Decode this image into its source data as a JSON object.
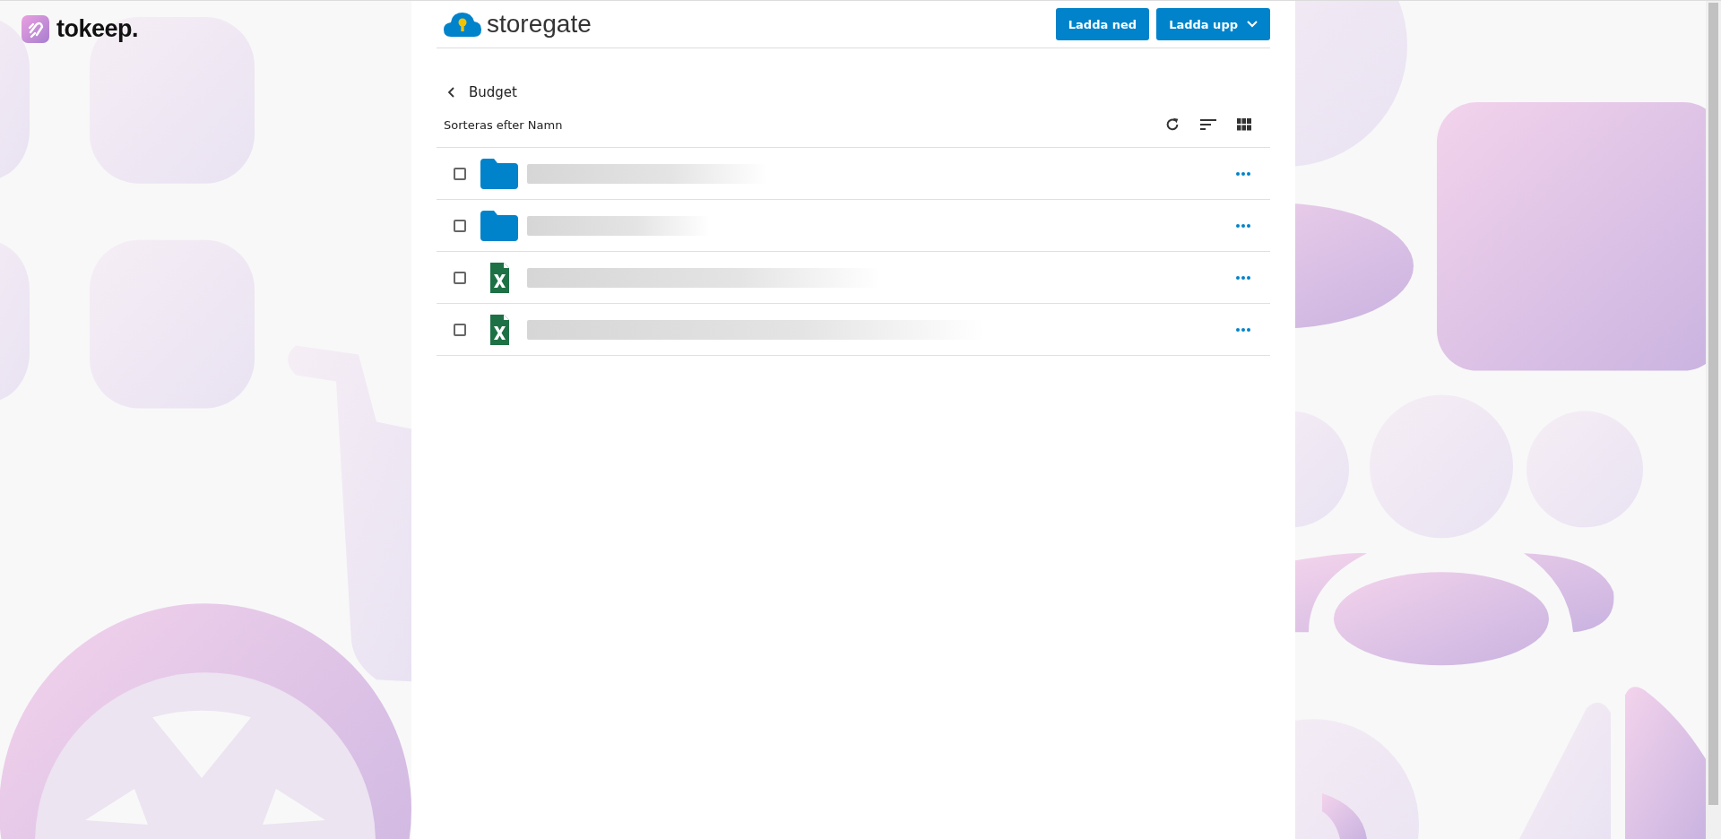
{
  "brand": {
    "name": "tokeep."
  },
  "app": {
    "logo_text": "storegate",
    "buttons": [
      {
        "label": "Ladda ned",
        "kind": "plain"
      },
      {
        "label": "Ladda upp",
        "kind": "dropdown"
      }
    ]
  },
  "folder": {
    "title": "Budget",
    "sort_label": "Sorteras efter Namn"
  },
  "rows": [
    {
      "kind": "folder",
      "checked": false
    },
    {
      "kind": "folder",
      "checked": false
    },
    {
      "kind": "excel",
      "checked": false
    },
    {
      "kind": "excel",
      "checked": false
    }
  ]
}
